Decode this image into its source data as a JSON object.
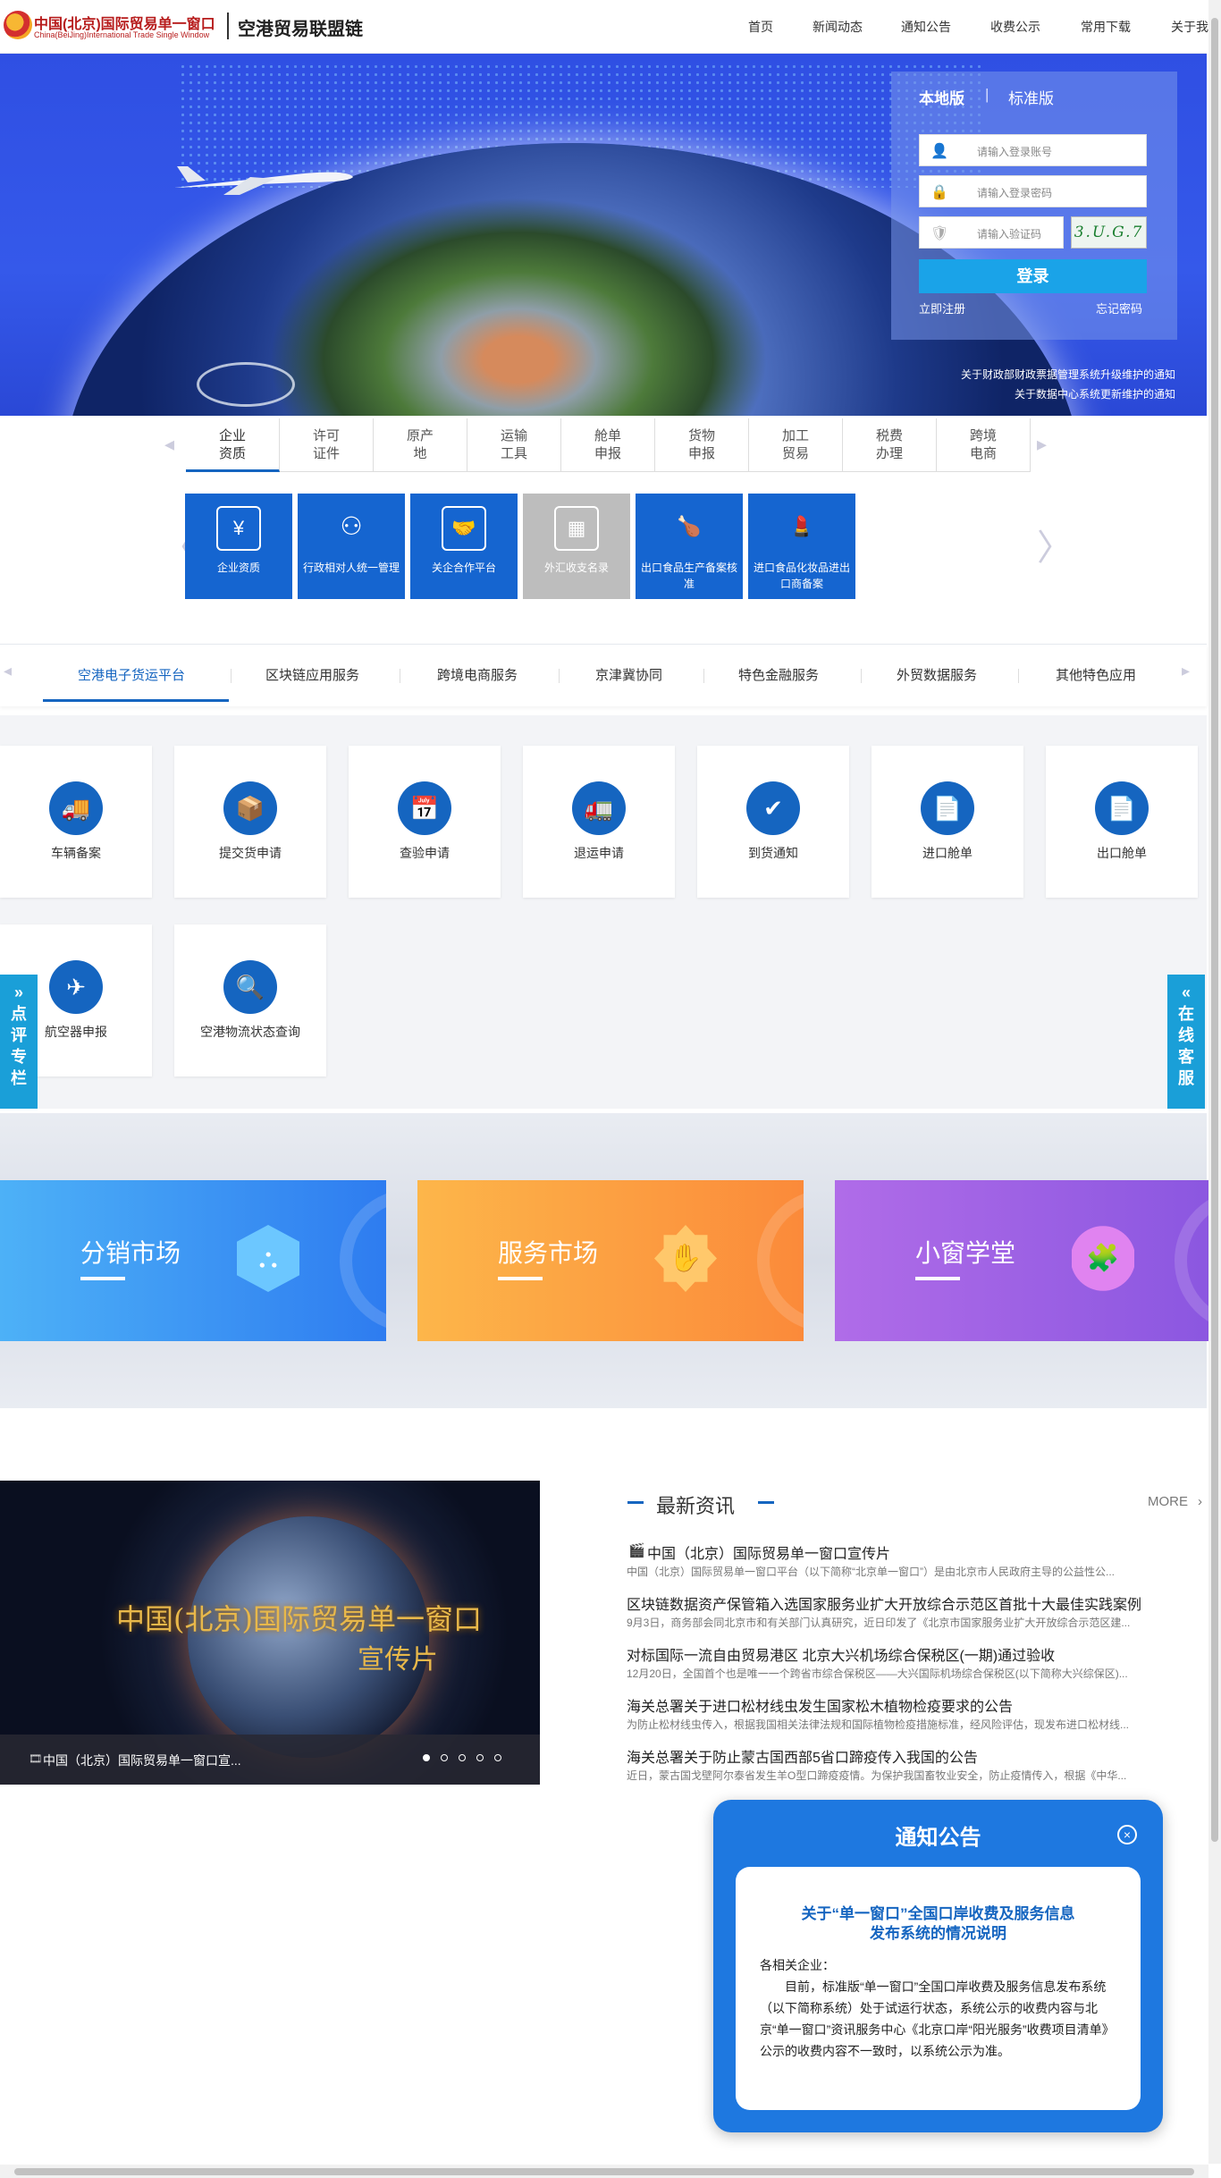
{
  "header": {
    "logo_cn": "中国(北京)国际贸易单一窗口",
    "logo_en": "China(BeiJing)International Trade Single Window",
    "subtitle": "空港贸易联盟链",
    "nav": [
      "首页",
      "新闻动态",
      "通知公告",
      "收费公示",
      "常用下载",
      "关于我"
    ]
  },
  "login": {
    "tab_local": "本地版",
    "tab_sep": "|",
    "tab_standard": "标准版",
    "account_placeholder": "请输入登录账号",
    "password_placeholder": "请输入登录密码",
    "captcha_placeholder": "请输入验证码",
    "captcha_text": "3.U.G.7",
    "login_button": "登录",
    "register": "立即注册",
    "forgot": "忘记密码"
  },
  "banner_ticker": [
    "关于财政部财政票据管理系统升级维护的通知",
    "关于数据中心系统更新维护的通知"
  ],
  "category_tabs": [
    {
      "line1": "企业",
      "line2": "资质"
    },
    {
      "line1": "许可",
      "line2": "证件"
    },
    {
      "line1": "原产",
      "line2": "地"
    },
    {
      "line1": "运输",
      "line2": "工具"
    },
    {
      "line1": "舱单",
      "line2": "申报"
    },
    {
      "line1": "货物",
      "line2": "申报"
    },
    {
      "line1": "加工",
      "line2": "贸易"
    },
    {
      "line1": "税费",
      "line2": "办理"
    },
    {
      "line1": "跨境",
      "line2": "电商"
    }
  ],
  "service_cards": [
    {
      "label": "企业资质",
      "icon": "monitor-icon"
    },
    {
      "label": "行政相对人统一管理",
      "icon": "people-network-icon"
    },
    {
      "label": "关企合作平台",
      "icon": "handshake-icon"
    },
    {
      "label": "外汇收支名录",
      "icon": "chart-icon"
    },
    {
      "label": "出口食品生产备案核准",
      "icon": "food-icon"
    },
    {
      "label": "进口食品化妆品进出口商备案",
      "icon": "cosmetics-icon"
    }
  ],
  "platform_tabs": [
    "空港电子货运平台",
    "区块链应用服务",
    "跨境电商服务",
    "京津冀协同",
    "特色金融服务",
    "外贸数据服务",
    "其他特色应用"
  ],
  "feature_cards": [
    {
      "label": "车辆备案",
      "icon": "truck-icon"
    },
    {
      "label": "提交货申请",
      "icon": "box-icon"
    },
    {
      "label": "查验申请",
      "icon": "calendar-icon"
    },
    {
      "label": "退运申请",
      "icon": "return-truck-icon"
    },
    {
      "label": "到货通知",
      "icon": "arrival-icon"
    },
    {
      "label": "进口舱单",
      "icon": "import-manifest-icon"
    },
    {
      "label": "出口舱单",
      "icon": "export-manifest-icon"
    },
    {
      "label": "航空器申报",
      "icon": "aircraft-icon"
    },
    {
      "label": "空港物流状态查询",
      "icon": "logistics-query-icon"
    }
  ],
  "side_left": "点评专栏",
  "side_right": "在线客服",
  "markets": [
    {
      "title": "分销市场",
      "icon": "network-icon",
      "color_from": "#4db1f7",
      "color_to": "#2e7cf0"
    },
    {
      "title": "服务市场",
      "icon": "handshake-icon",
      "color_from": "#fdb64a",
      "color_to": "#fb8a3a"
    },
    {
      "title": "小窗学堂",
      "icon": "puzzle-icon",
      "color_from": "#b06ce8",
      "color_to": "#8a56e0"
    }
  ],
  "video": {
    "title_overlay": "中国(北京)国际贸易单一窗口",
    "subtitle_overlay": "宣传片",
    "caption": "中国（北京）国际贸易单一窗口宣..."
  },
  "news": {
    "heading": "最新资讯",
    "more": "MORE",
    "items": [
      {
        "title": "中国（北京）国际贸易单一窗口宣传片",
        "desc": "中国（北京）国际贸易单一窗口平台（以下简称“北京单一窗口”）是由北京市人民政府主导的公益性公..."
      },
      {
        "title": "区块链数据资产保管箱入选国家服务业扩大开放综合示范区首批十大最佳实践案例",
        "desc": "9月3日，商务部会同北京市和有关部门认真研究，近日印发了《北京市国家服务业扩大开放综合示范区建..."
      },
      {
        "title": "对标国际一流自由贸易港区 北京大兴机场综合保税区(一期)通过验收",
        "desc": "12月20日，全国首个也是唯一一个跨省市综合保税区——大兴国际机场综合保税区(以下简称大兴综保区)..."
      },
      {
        "title": "海关总署关于进口松材线虫发生国家松木植物检疫要求的公告",
        "desc": "为防止松材线虫传入，根据我国相关法律法规和国际植物检疫措施标准，经风险评估，现发布进口松材线..."
      },
      {
        "title": "海关总署关于防止蒙古国西部5省口蹄疫传入我国的公告",
        "desc": "近日，蒙古国戈壁阿尔泰省发生羊O型口蹄疫疫情。为保护我国畜牧业安全，防止疫情传入，根据《中华..."
      }
    ]
  },
  "notice": {
    "title": "通知公告",
    "close": "×",
    "heading_line1": "关于“单一窗口”全国口岸收费及服务信息",
    "heading_line2": "发布系统的情况说明",
    "salutation": "各相关企业：",
    "body": "目前，标准版“单一窗口”全国口岸收费及服务信息发布系统（以下简称系统）处于试运行状态，系统公示的收费内容与北京“单一窗口”资讯服务中心《北京口岸“阳光服务”收费项目清单》公示的收费内容不一致时，以系统公示为准。"
  }
}
